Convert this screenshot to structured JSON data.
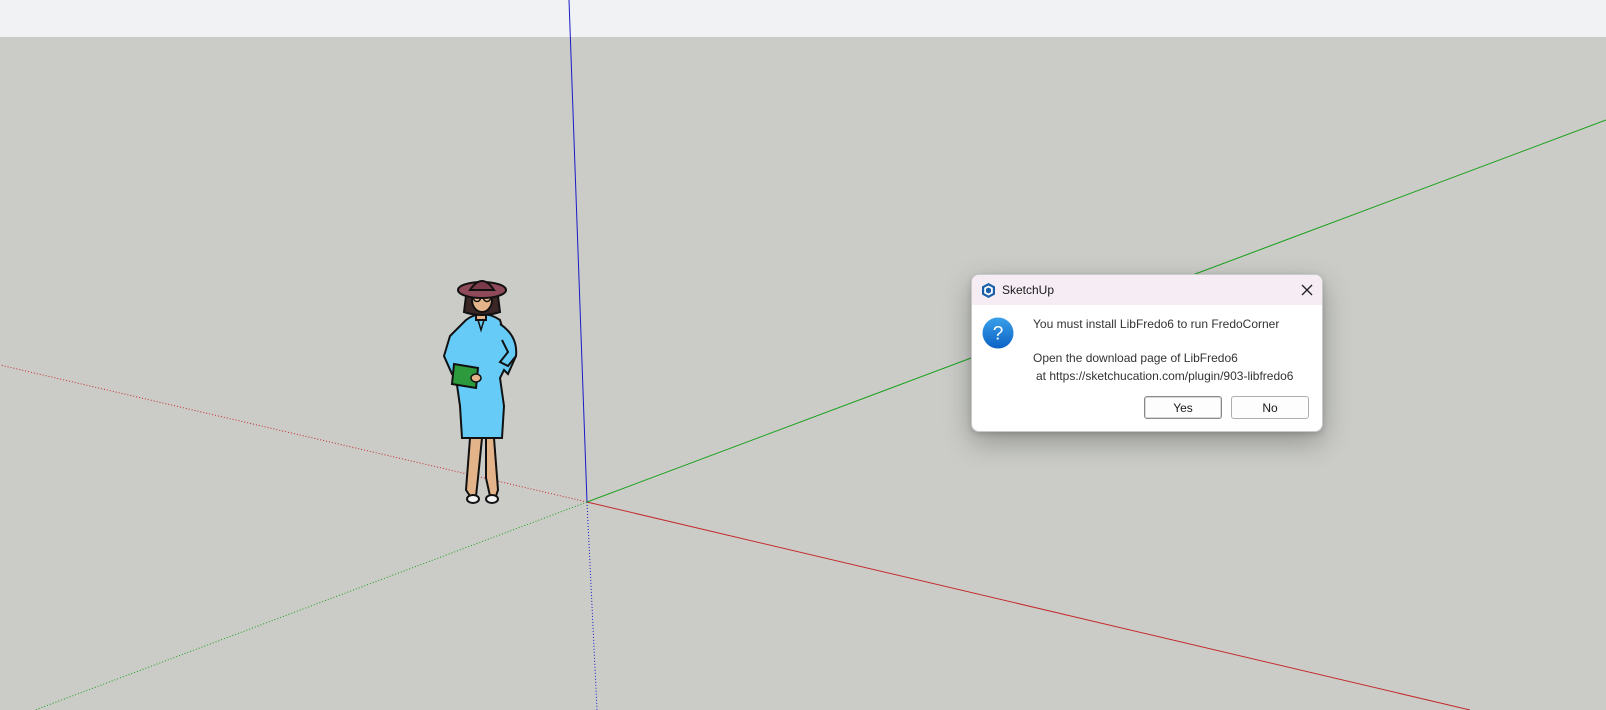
{
  "dialog": {
    "title": "SketchUp",
    "message_line1": "You must install LibFredo6 to run FredoCorner",
    "message_line2": "Open the download page of LibFredo6",
    "message_line3": "at https://sketchucation.com/plugin/903-libfredo6",
    "yes_label": "Yes",
    "no_label": "No",
    "icons": {
      "app": "sketchup-logo-icon",
      "close": "close-icon",
      "message": "question-icon"
    }
  },
  "viewport": {
    "background": "#cbccc8",
    "axes": {
      "red": "#c42b2b",
      "green": "#1aa01a",
      "blue": "#1a1ac8"
    }
  }
}
